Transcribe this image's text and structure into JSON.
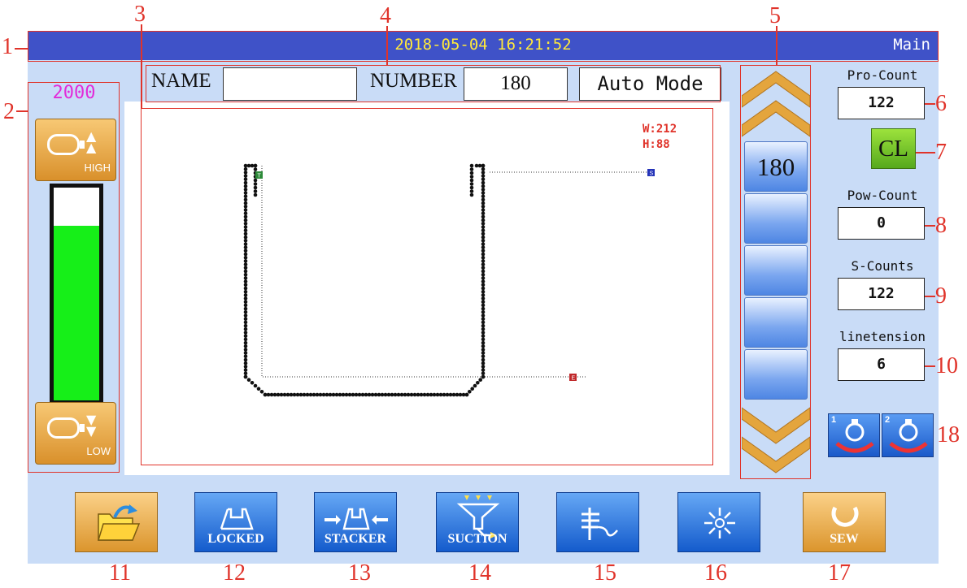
{
  "header": {
    "datetime": "2018-05-04  16:21:52",
    "screen": "Main"
  },
  "speed": {
    "value": "2000",
    "high_label": "HIGH",
    "low_label": "LOW",
    "level": 0.82
  },
  "info": {
    "name_label": "NAME",
    "name_value": "",
    "number_label": "NUMBER",
    "number_value": "180",
    "mode": "Auto Mode"
  },
  "pattern": {
    "width_text": "W:212",
    "height_text": "H:88",
    "markers": {
      "start": "S",
      "end": "E",
      "thread": "T"
    }
  },
  "needle": {
    "buttons": [
      "180",
      "",
      "",
      "",
      ""
    ]
  },
  "counters": {
    "pro_label": "Pro-Count",
    "pro_value": "122",
    "clear_label": "CL",
    "pow_label": "Pow-Count",
    "pow_value": "0",
    "s_label": "S-Counts",
    "s_value": "122",
    "tension_label": "linetension",
    "tension_value": "6"
  },
  "lamps": [
    "1",
    "2"
  ],
  "toolbar": {
    "locked": "LOCKED",
    "stacker": "STACKER",
    "suction": "SUCTION",
    "sew": "SEW"
  },
  "callouts": [
    "1",
    "2",
    "3",
    "4",
    "5",
    "6",
    "7",
    "8",
    "9",
    "10",
    "18",
    "11",
    "12",
    "13",
    "14",
    "15",
    "16",
    "17"
  ],
  "colors": {
    "panel": "#c9dcf7",
    "titlebar": "#3f52c8",
    "datetime": "#ffe93a",
    "speed_value": "#e22bd9",
    "speed_fill": "#16ef18",
    "annotation": "#e0332a"
  }
}
